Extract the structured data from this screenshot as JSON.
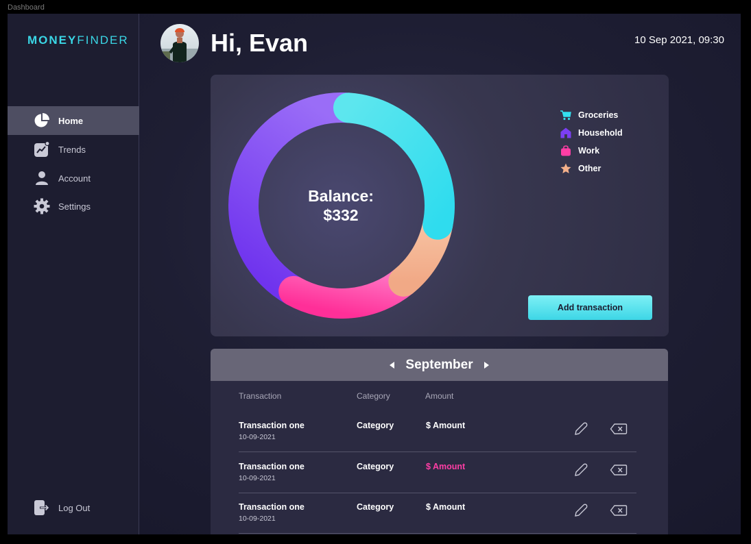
{
  "frame_label": "Dashboard",
  "brand": {
    "part1": "MONEY",
    "part2": "FINDER"
  },
  "sidebar": {
    "items": [
      {
        "label": "Home",
        "icon": "pie-chart-icon",
        "active": true
      },
      {
        "label": "Trends",
        "icon": "trend-chart-icon"
      },
      {
        "label": "Account",
        "icon": "user-icon"
      },
      {
        "label": "Settings",
        "icon": "gear-icon"
      }
    ],
    "logout_label": "Log Out"
  },
  "header": {
    "greeting": "Hi, Evan",
    "datetime": "10 Sep 2021, 09:30"
  },
  "balance": {
    "line1": "Balance:",
    "line2": "$332",
    "add_button": "Add transaction",
    "legend": [
      {
        "label": "Groceries",
        "icon": "cart-icon",
        "color": "#34e0ef"
      },
      {
        "label": "Household",
        "icon": "house-icon",
        "color": "#7b3ff2"
      },
      {
        "label": "Work",
        "icon": "bag-icon",
        "color": "#ff3ea5"
      },
      {
        "label": "Other",
        "icon": "star-icon",
        "color": "#f4b08a"
      }
    ],
    "donut_share": [
      {
        "category": "Groceries",
        "share": 0.27,
        "color": "#34e0ef"
      },
      {
        "category": "Other",
        "share": 0.11,
        "color": "#f4b08a"
      },
      {
        "category": "Work",
        "share": 0.19,
        "color": "#ff3ea5"
      },
      {
        "category": "Household",
        "share": 0.43,
        "color": "#7b3ff2"
      }
    ]
  },
  "transactions": {
    "month": "September",
    "columns": {
      "transaction": "Transaction",
      "category": "Category",
      "amount": "Amount"
    },
    "rows": [
      {
        "name": "Transaction one",
        "date": "10-09-2021",
        "category": "Category",
        "amount": "$ Amount",
        "negative": false
      },
      {
        "name": "Transaction one",
        "date": "10-09-2021",
        "category": "Category",
        "amount": "$ Amount",
        "negative": true
      },
      {
        "name": "Transaction one",
        "date": "10-09-2021",
        "category": "Category",
        "amount": "$ Amount",
        "negative": false
      }
    ]
  }
}
